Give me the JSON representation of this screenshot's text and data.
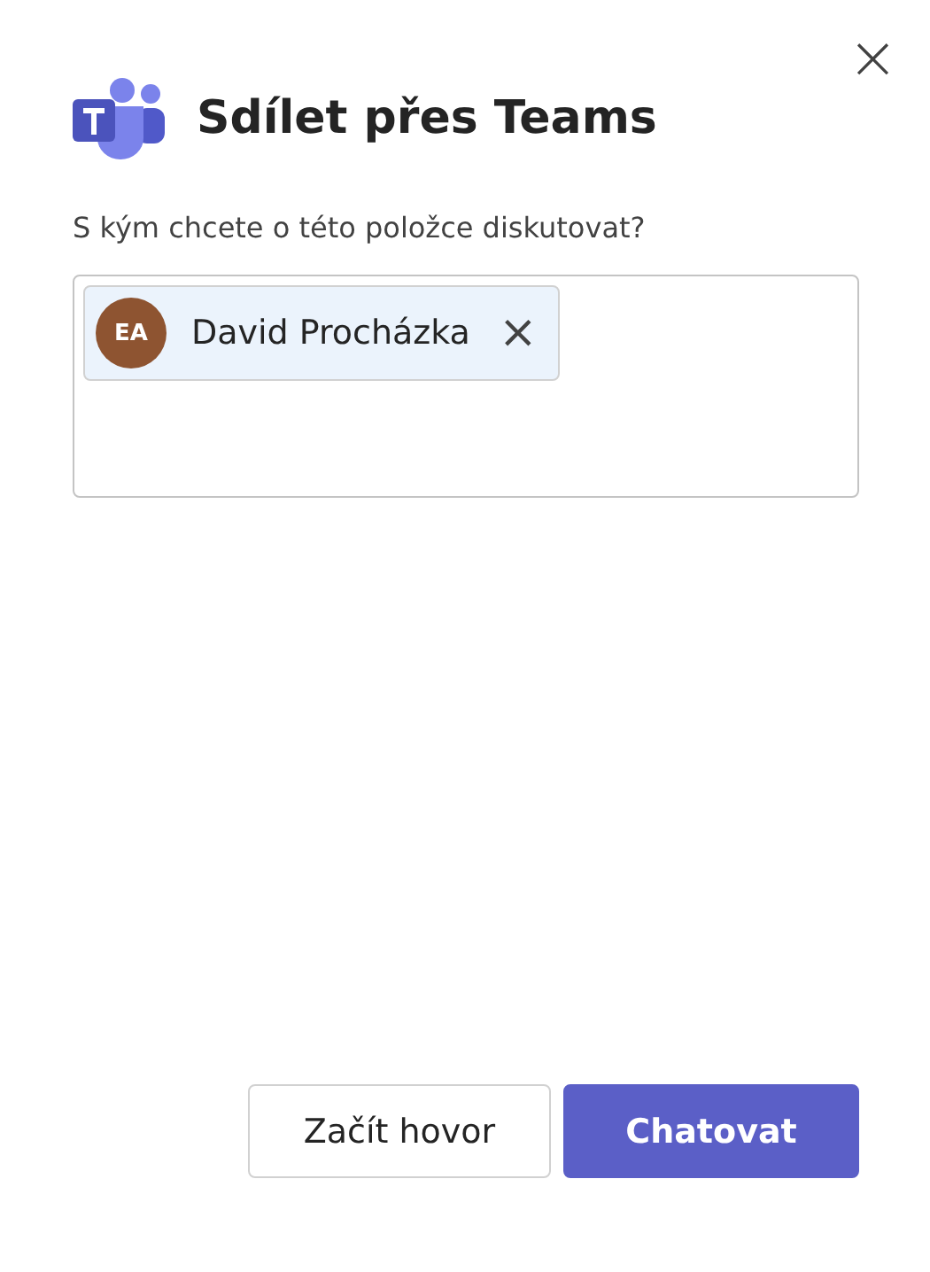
{
  "dialog": {
    "title": "Sdílet přes Teams",
    "close_label": "×"
  },
  "prompt": "S kým chcete o této položce diskutovat?",
  "recipients": [
    {
      "initials": "EA",
      "name": "David Procházka",
      "color": "#8e5431",
      "remove_label": "×"
    }
  ],
  "buttons": [
    {
      "label": "Začít hovor",
      "kind": "secondary"
    },
    {
      "label": "Chatovat",
      "kind": "primary"
    }
  ]
}
